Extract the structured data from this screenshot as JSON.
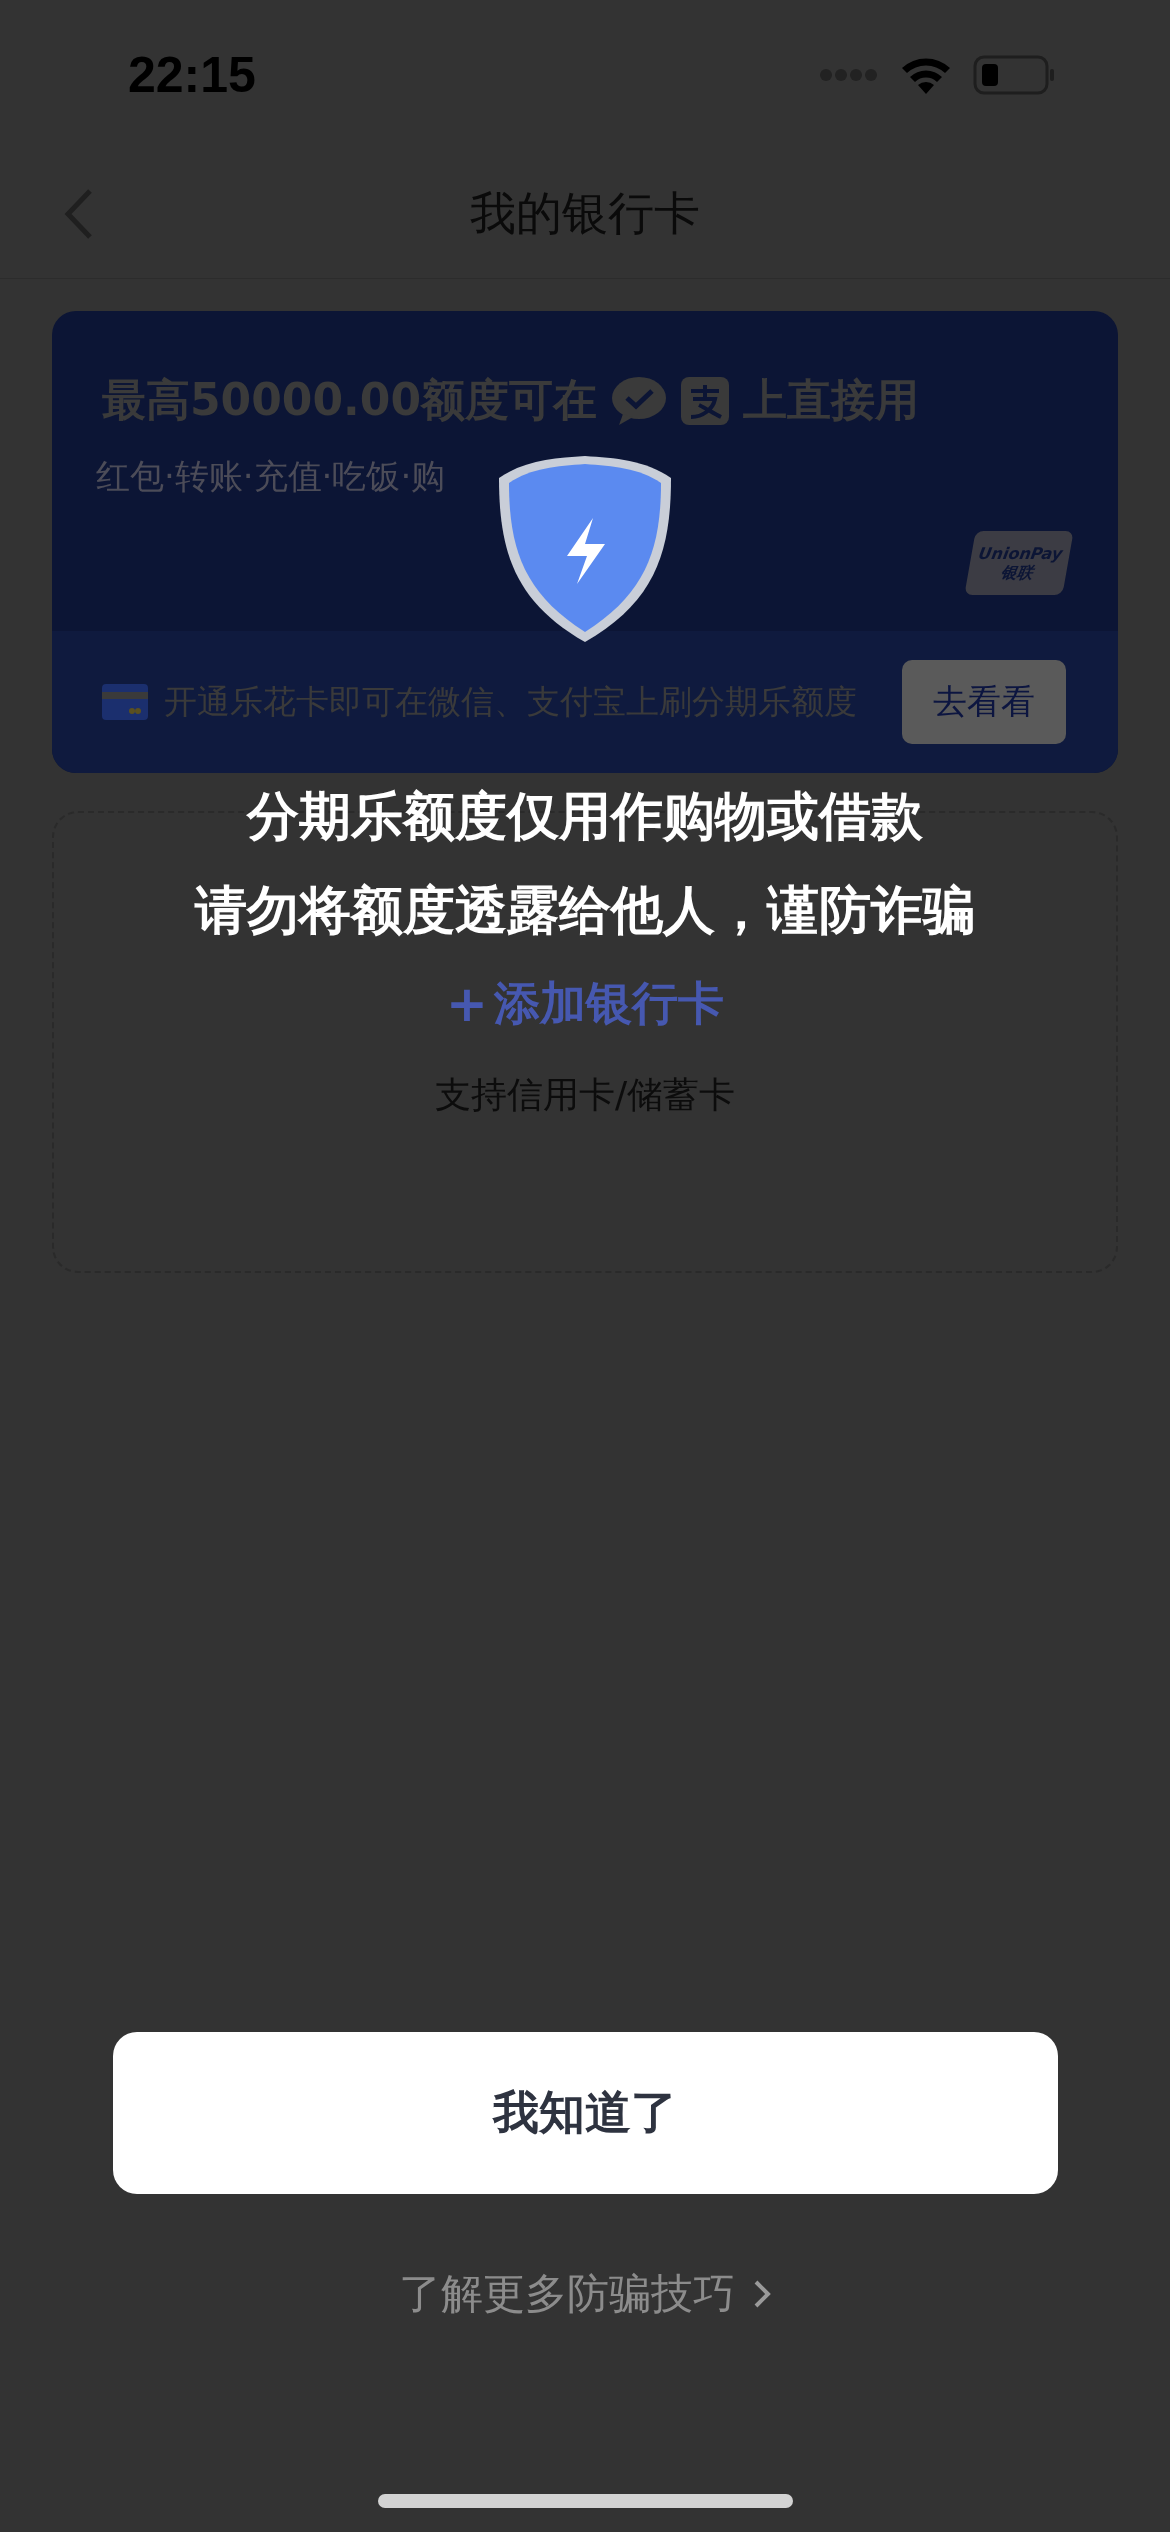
{
  "status_bar": {
    "time": "22:15"
  },
  "nav": {
    "title": "我的银行卡"
  },
  "promo_card": {
    "title_before": "最高50000.00额度可在",
    "title_after": "上直接用",
    "subtitle": "红包·转账·充值·吃饭·购",
    "logo_top": "UnionPay",
    "logo_bottom": "银联",
    "notice": "开通乐花卡即可在微信、支付宝上刷分期乐额度",
    "button": "去看看"
  },
  "add_card": {
    "plus": "+",
    "label": "添加银行卡",
    "hint": "支持信用卡/储蓄卡"
  },
  "dialog": {
    "lines": [
      "分期乐额度仅用作购物或借款",
      "请勿将额度透露给他人，谨防诈骗"
    ],
    "button": "我知道了",
    "link": "了解更多防骗技巧"
  }
}
